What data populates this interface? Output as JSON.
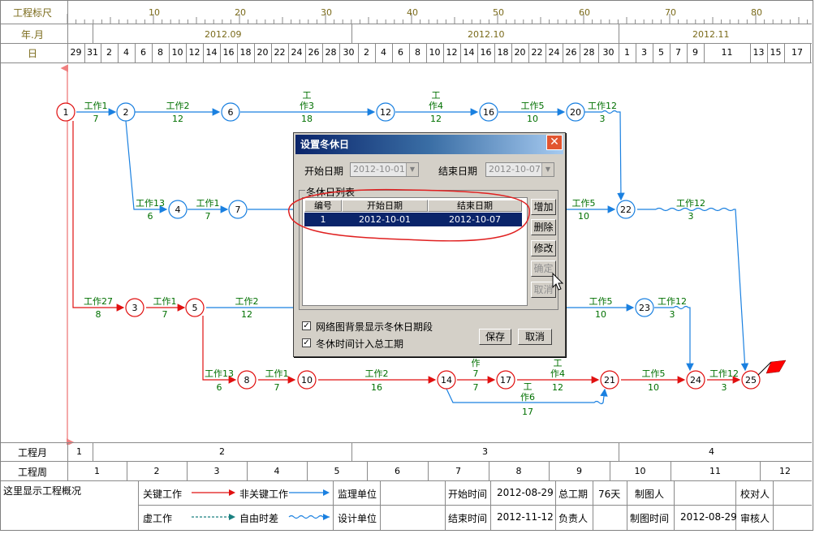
{
  "header": {
    "row1_label": "工程标尺",
    "row2_label": "年.月",
    "row3_label": "日",
    "scale_ticks": [
      "10",
      "20",
      "30",
      "40",
      "50",
      "60",
      "70",
      "80"
    ],
    "months": [
      "2012.09",
      "2012.10",
      "2012.11"
    ],
    "days": [
      "29",
      "31",
      "2",
      "4",
      "6",
      "8",
      "10",
      "12",
      "14",
      "16",
      "18",
      "20",
      "22",
      "24",
      "26",
      "28",
      "30",
      "2",
      "4",
      "6",
      "8",
      "10",
      "12",
      "14",
      "16",
      "18",
      "20",
      "22",
      "24",
      "26",
      "28",
      "30",
      "1",
      "3",
      "5",
      "7",
      "9",
      "11",
      "13",
      "15",
      "17"
    ]
  },
  "footer": {
    "month_label": "工程月",
    "month_values": [
      "1",
      "2",
      "3",
      "4"
    ],
    "week_label": "工程周",
    "week_values": [
      "1",
      "2",
      "3",
      "4",
      "5",
      "6",
      "7",
      "8",
      "9",
      "10",
      "11",
      "12"
    ]
  },
  "legend": {
    "overview": "这里显示工程概况",
    "critical": "关键工作",
    "noncritical": "非关键工作",
    "dummy": "虚工作",
    "float": "自由时差",
    "supervisor": "监理单位",
    "designer": "设计单位",
    "start_label": "开始时间",
    "start_value": "2012-08-29",
    "end_label": "结束时间",
    "end_value": "2012-11-12",
    "duration_label": "总工期",
    "duration_value": "76天",
    "owner_label": "负责人",
    "drawer_label": "制图人",
    "draw_time_label": "制图时间",
    "draw_time_value": "2012-08-29",
    "checker_label": "校对人",
    "reviewer_label": "审核人"
  },
  "network": {
    "nodes": [
      "1",
      "2",
      "6",
      "12",
      "16",
      "20",
      "22",
      "4",
      "7",
      "3",
      "5",
      "23",
      "8",
      "10",
      "14",
      "17",
      "21",
      "24",
      "25"
    ],
    "labels": {
      "a1": "工作1",
      "a1d": "7",
      "a2": "工作2",
      "a2d": "12",
      "a3a": "工",
      "a3b": "作3",
      "a3d": "18",
      "a4a": "工",
      "a4b": "作4",
      "a4d": "12",
      "a5": "工作5",
      "a5d": "10",
      "a12": "工作12",
      "a12d": "3",
      "b13": "工作13",
      "b13d": "6",
      "b1": "工作1",
      "b1d": "7",
      "b5": "工作5",
      "b5d": "10",
      "b12": "工作12",
      "b12d": "3",
      "c27": "工作27",
      "c27d": "8",
      "c1": "工作1",
      "c1d": "7",
      "c2": "工作2",
      "c2d": "12",
      "c5": "工作5",
      "c5d": "10",
      "c12": "工作12",
      "c12d": "3",
      "d13": "工作13",
      "d13d": "6",
      "d1": "工作1",
      "d1d": "7",
      "d2": "工作2",
      "d2d": "16",
      "d7a": "作",
      "d7b": "7",
      "d7d": "7",
      "d4a": "工",
      "d4b": "作4",
      "d4d": "12",
      "d6a": "工",
      "d6b": "作6",
      "d6d": "17",
      "d5": "工作5",
      "d5d": "10",
      "d12": "工作12",
      "d12d": "3"
    }
  },
  "dialog": {
    "title": "设置冬休日",
    "start_label": "开始日期",
    "start_value": "2012-10-01",
    "end_label": "结束日期",
    "end_value": "2012-10-07",
    "group_label": "冬休日列表",
    "columns": [
      "编号",
      "开始日期",
      "结束日期"
    ],
    "rows": [
      {
        "id": "1",
        "start": "2012-10-01",
        "end": "2012-10-07"
      }
    ],
    "add": "增加",
    "delete": "删除",
    "modify": "修改",
    "ok": "确定",
    "cancel_side": "取消",
    "check1": "网络图背景显示冬休日期段",
    "check2": "冬休时间计入总工期",
    "save": "保存",
    "cancel": "取消"
  },
  "colors": {
    "critical": "#e01010",
    "noncritical": "#1a80e0",
    "label_green": "#007000",
    "dialog_highlight": "#0a246a"
  }
}
